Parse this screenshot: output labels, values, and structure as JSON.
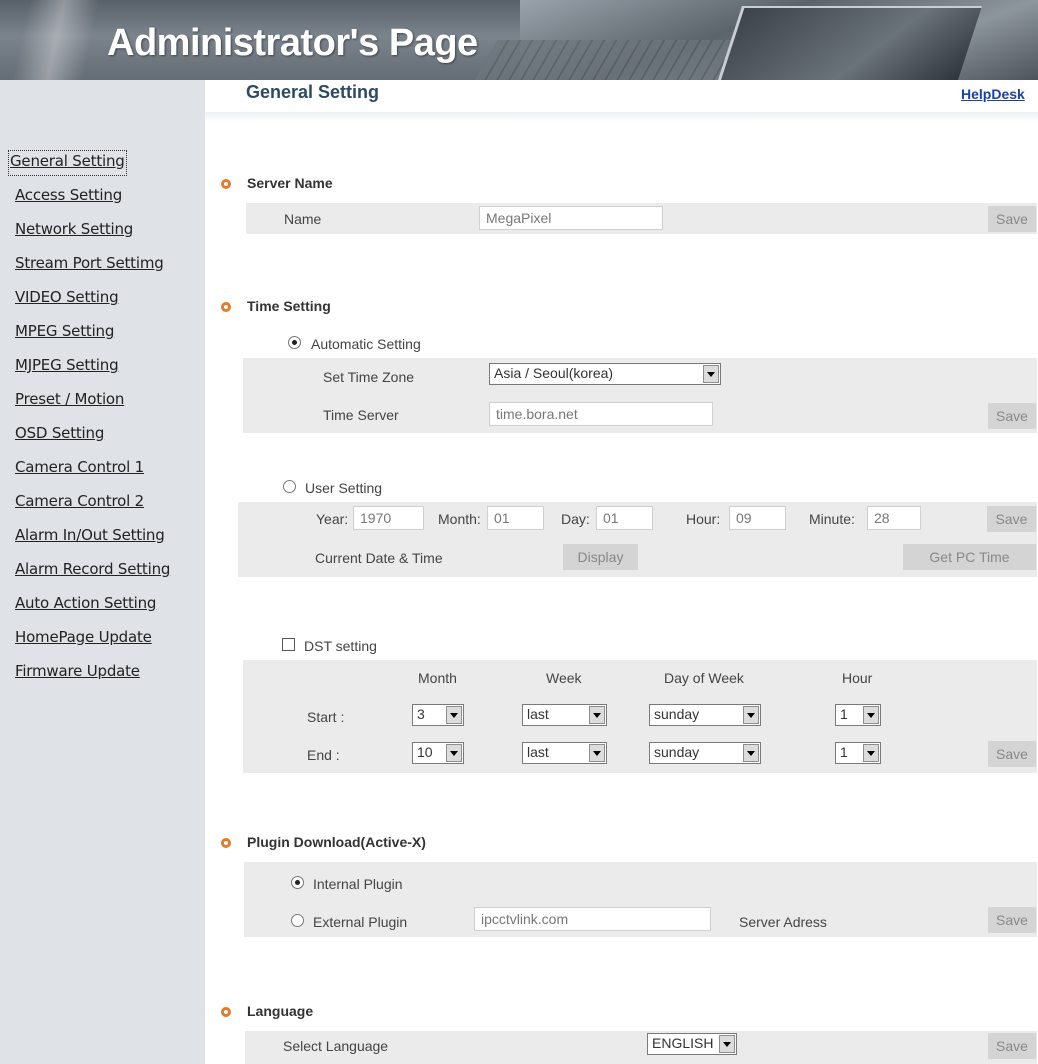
{
  "header": {
    "title": "Administrator's Page"
  },
  "page": {
    "title": "General Setting",
    "helpdesk": "HelpDesk"
  },
  "sidebar": {
    "items": [
      {
        "label": "General Setting"
      },
      {
        "label": "Access Setting"
      },
      {
        "label": "Network Setting"
      },
      {
        "label": "Stream Port Settimg"
      },
      {
        "label": "VIDEO Setting"
      },
      {
        "label": "MPEG Setting"
      },
      {
        "label": "MJPEG Setting"
      },
      {
        "label": "Preset / Motion"
      },
      {
        "label": "OSD Setting"
      },
      {
        "label": "Camera Control 1"
      },
      {
        "label": "Camera Control 2"
      },
      {
        "label": "Alarm In/Out Setting"
      },
      {
        "label": "Alarm Record Setting"
      },
      {
        "label": "Auto Action Setting"
      },
      {
        "label": "HomePage Update"
      },
      {
        "label": "Firmware Update"
      }
    ]
  },
  "server_name": {
    "title": "Server Name",
    "name_label": "Name",
    "name_value": "MegaPixel",
    "save": "Save"
  },
  "time_setting": {
    "title": "Time Setting",
    "automatic": {
      "label": "Automatic Setting",
      "selected": true,
      "tz_label": "Set Time Zone",
      "tz_value": "Asia / Seoul(korea)",
      "server_label": "Time Server",
      "server_value": "time.bora.net",
      "save": "Save"
    },
    "user": {
      "label": "User Setting",
      "selected": false,
      "year_label": "Year:",
      "year_value": "1970",
      "month_label": "Month:",
      "month_value": "01",
      "day_label": "Day:",
      "day_value": "01",
      "hour_label": "Hour:",
      "hour_value": "09",
      "minute_label": "Minute:",
      "minute_value": "28",
      "save": "Save",
      "current_label": "Current Date & Time",
      "display": "Display",
      "get_pc_time": "Get PC Time"
    },
    "dst": {
      "label": "DST setting",
      "checked": false,
      "col_month": "Month",
      "col_week": "Week",
      "col_dow": "Day of Week",
      "col_hour": "Hour",
      "start_label": "Start :",
      "end_label": "End :",
      "start": {
        "month": "3",
        "week": "last",
        "dow": "sunday",
        "hour": "1"
      },
      "end": {
        "month": "10",
        "week": "last",
        "dow": "sunday",
        "hour": "1"
      },
      "save": "Save"
    }
  },
  "plugin": {
    "title": "Plugin Download(Active-X)",
    "internal_label": "Internal Plugin",
    "internal_selected": true,
    "external_label": "External Plugin",
    "external_value": "ipcctvlink.com",
    "server_label": "Server Adress",
    "save": "Save"
  },
  "language": {
    "title": "Language",
    "select_label": "Select Language",
    "value": "ENGLISH",
    "save": "Save"
  },
  "colors": {
    "bullet": "#e8782a",
    "panel": "#ebebeb",
    "sidebar": "#dfe3e7",
    "title": "#2b4a66",
    "link": "#1a3fb0"
  }
}
